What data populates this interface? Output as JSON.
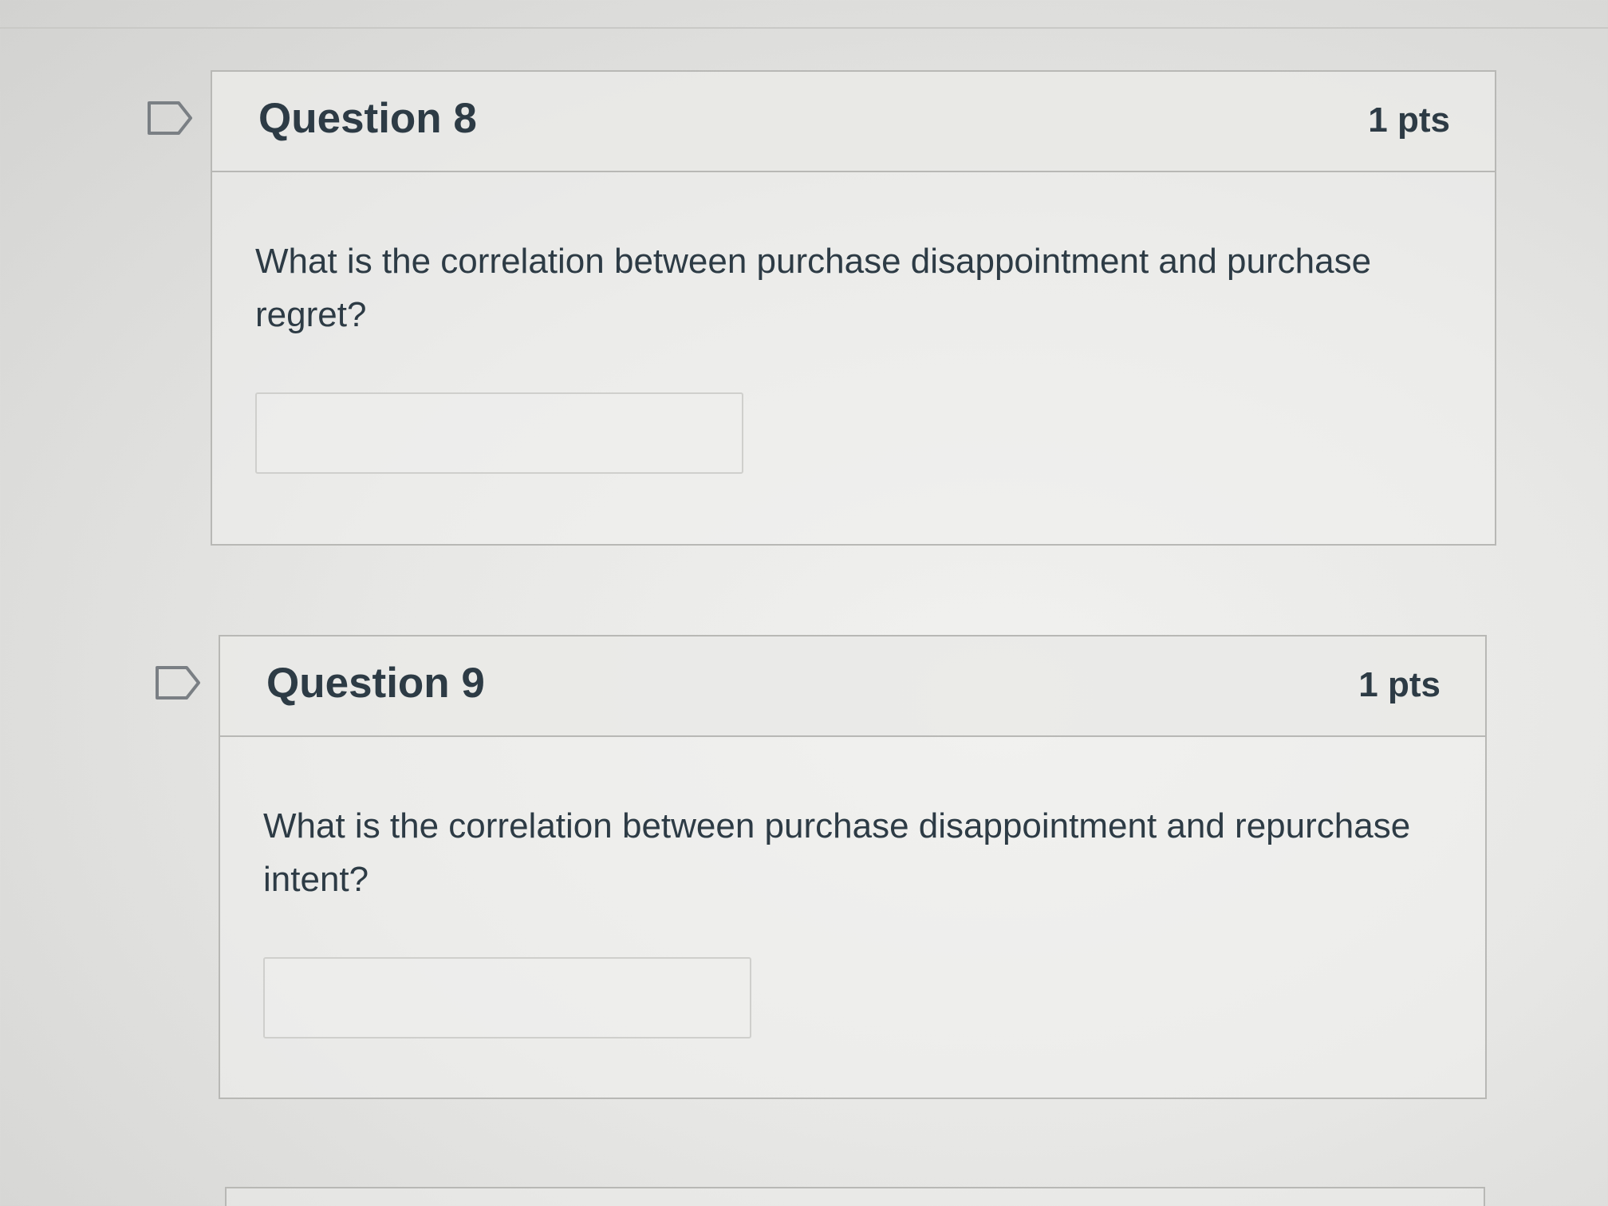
{
  "questions": [
    {
      "title": "Question 8",
      "points": "1 pts",
      "text": "What is the correlation between purchase disappointment and purchase regret?",
      "answer_value": "",
      "flag_icon": "flag-outline-icon"
    },
    {
      "title": "Question 9",
      "points": "1 pts",
      "text": "What is the correlation between purchase disappointment and repurchase intent?",
      "answer_value": "",
      "flag_icon": "flag-outline-icon"
    }
  ],
  "colors": {
    "text": "#2d3b45",
    "border": "#b8b8b5",
    "background": "#e7e7e5"
  }
}
